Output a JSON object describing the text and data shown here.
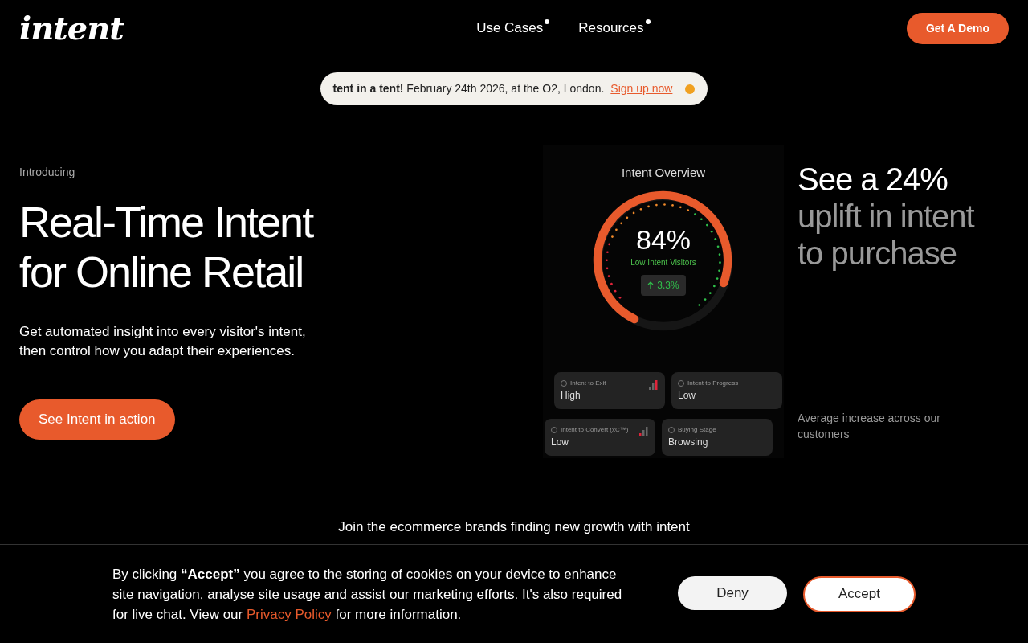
{
  "header": {
    "logo": "intent",
    "nav": [
      {
        "label": "Use Cases"
      },
      {
        "label": "Resources"
      }
    ],
    "cta": "Get A Demo"
  },
  "banner": {
    "text": "**tent in a tent!** February 24th 2026, at the O2, London.",
    "link": "Sign up now"
  },
  "hero": {
    "eyebrow": "Introducing",
    "title_lines": [
      "Real-Time Intent",
      "for Online Retail"
    ],
    "description_lines": [
      "Get automated insight into every visitor's intent,",
      "then control how you adapt their experiences."
    ],
    "button": "See Intent in action"
  },
  "dashboard": {
    "title": "Intent Overview",
    "value": "84%",
    "caption": "Low Intent Visitors",
    "change": "3.3%",
    "cards": [
      [
        {
          "label": "Intent to Exit",
          "value": "High",
          "kind": "high"
        },
        {
          "label": "Intent to Progress",
          "value": "Low",
          "kind": "plain"
        }
      ],
      [
        {
          "label": "Intent to Convert (xC™)",
          "value": "Low",
          "kind": "low"
        },
        {
          "label": "Buying Stage",
          "value": "Browsing",
          "kind": "plain"
        }
      ]
    ]
  },
  "stat": {
    "headline": "See a 24%",
    "subline_lines": [
      "uplift in intent",
      "to purchase"
    ],
    "note_lines": [
      "Average increase across our",
      "customers"
    ]
  },
  "brands_heading": "Join the ecommerce brands finding new growth with intent",
  "cookie": {
    "text_before": "By clicking **“Accept”** you agree to the storing of cookies on your device to enhance site navigation, analyse site usage and assist our marketing efforts. It's also required for live chat. View our",
    "link": "Privacy Policy",
    "text_after": "for more information.",
    "buttons": [
      {
        "label": "Deny",
        "kind": "secondary"
      },
      {
        "label": "Accept",
        "kind": "primary"
      }
    ]
  }
}
